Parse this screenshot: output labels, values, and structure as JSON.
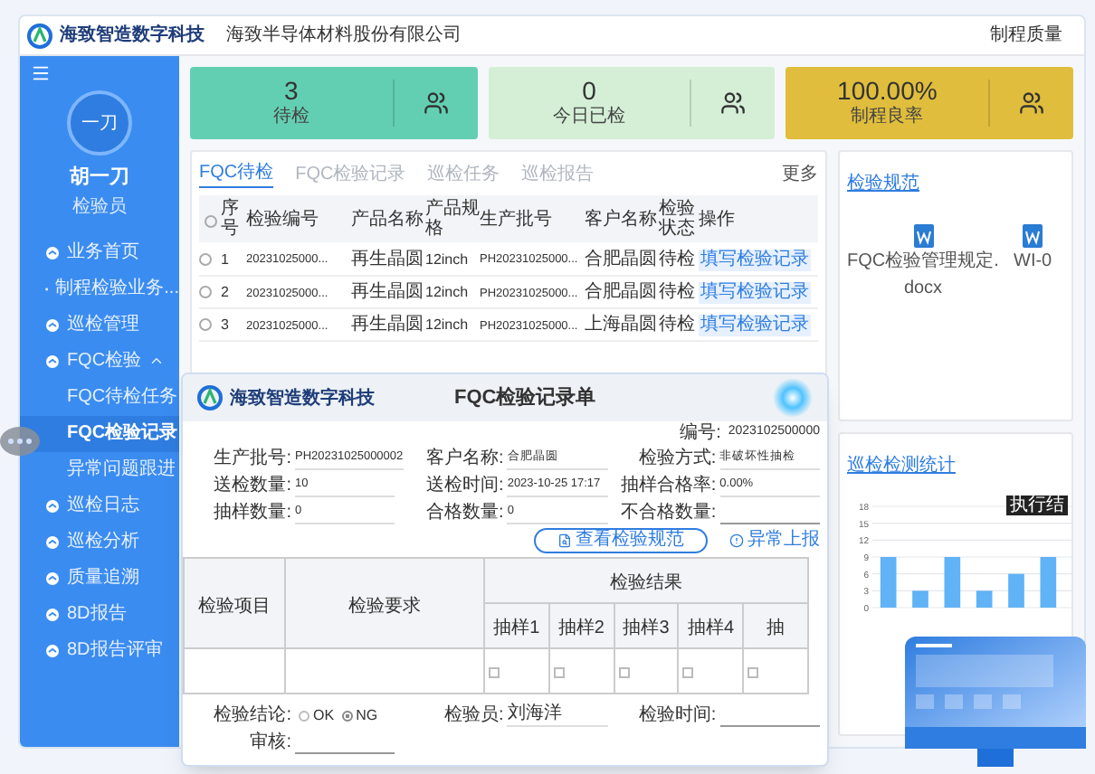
{
  "header": {
    "logo_text": "海致智造数字科技",
    "company": "海致半导体材料股份有限公司",
    "right_link": "制程质量"
  },
  "sidebar": {
    "user": {
      "avatar": "一刀",
      "name": "胡一刀",
      "role": "检验员"
    },
    "items": [
      {
        "label": "业务首页",
        "selected": false
      },
      {
        "label": "制程检验业务...",
        "selected": false
      },
      {
        "label": "巡检管理",
        "selected": false
      },
      {
        "label": "FQC检验",
        "selected": false,
        "expanded": true,
        "children": [
          {
            "label": "FQC待检任务",
            "selected": false
          },
          {
            "label": "FQC检验记录",
            "selected": true
          },
          {
            "label": "异常问题跟进",
            "selected": false
          }
        ]
      },
      {
        "label": "巡检日志",
        "selected": false
      },
      {
        "label": "巡检分析",
        "selected": false
      },
      {
        "label": "质量追溯",
        "selected": false
      },
      {
        "label": "8D报告",
        "selected": false
      },
      {
        "label": "8D报告评审",
        "selected": false
      }
    ]
  },
  "stats": [
    {
      "value": "3",
      "label": "待检",
      "color": "#63cfb2"
    },
    {
      "value": "0",
      "label": "今日已检",
      "color": "#d4efd6"
    },
    {
      "value": "100.00%",
      "label": "制程良率",
      "color": "#e0bd3c"
    }
  ],
  "tasks": {
    "tabs": [
      {
        "label": "FQC待检",
        "selected": true
      },
      {
        "label": "FQC检验记录",
        "selected": false
      },
      {
        "label": "巡检任务",
        "selected": false
      },
      {
        "label": "巡检报告",
        "selected": false
      }
    ],
    "more": "更多",
    "all_checked": false,
    "columns": [
      "序号",
      "检验编号",
      "产品名称",
      "产品规格",
      "生产批号",
      "客户名称",
      "检验状态",
      "操作"
    ],
    "rows": [
      {
        "checked": false,
        "cells": [
          "1",
          "20231025000...",
          "再生晶圆",
          "12inch",
          "PH20231025000...",
          "合肥晶圆",
          "待检"
        ],
        "action": "填写检验记录"
      },
      {
        "checked": false,
        "cells": [
          "2",
          "20231025000...",
          "再生晶圆",
          "12inch",
          "PH20231025000...",
          "合肥晶圆",
          "待检"
        ],
        "action": "填写检验记录"
      },
      {
        "checked": false,
        "cells": [
          "3",
          "20231025000...",
          "再生晶圆",
          "12inch",
          "PH20231025000...",
          "上海晶圆",
          "待检"
        ],
        "action": "填写检验记录"
      }
    ]
  },
  "spec": {
    "title": "检验规范",
    "files": [
      "FQC检验管理规定.docx",
      "WI-0"
    ]
  },
  "inspection_chart": {
    "title": "巡检检测统计",
    "tooltip": "执行结",
    "chart_data": {
      "type": "bar",
      "values": [
        9,
        3,
        9,
        3,
        6,
        9
      ],
      "ylim": [
        0,
        18
      ],
      "grid": true,
      "yticks": [
        0,
        3,
        6,
        9,
        12,
        15,
        18
      ]
    }
  },
  "record": {
    "logo_text": "海致智造数字科技",
    "title": "FQC检验记录单",
    "number_label": "编号:",
    "number": "2023102500000",
    "fields": [
      {
        "label": "生产批号:",
        "value": "PH20231025000002"
      },
      {
        "label": "客户名称:",
        "value": "合肥晶圆"
      },
      {
        "label": "检验方式:",
        "value": "非破坏性抽检"
      },
      {
        "label": "送检数量:",
        "value": "10"
      },
      {
        "label": "送检时间:",
        "value": "2023-10-25 17:17"
      },
      {
        "label": "抽样合格率:",
        "value": "0.00%"
      },
      {
        "label": "抽样数量:",
        "value": "0"
      },
      {
        "label": "合格数量:",
        "value": "0"
      },
      {
        "label": "不合格数量:"
      }
    ],
    "buttons": [
      {
        "label": "查看检验规范",
        "kind": "outline"
      },
      {
        "label": "异常上报",
        "kind": "link"
      }
    ],
    "table": {
      "columns": [
        "检验项目",
        "检验要求"
      ],
      "result_header": "检验结果",
      "samples": [
        "抽样1",
        "抽样2",
        "抽样3",
        "抽样4",
        "抽"
      ],
      "rows": [
        {
          "samples": [
            false,
            false,
            false,
            false,
            false
          ]
        }
      ]
    },
    "conclusion": {
      "label": "检验结论:",
      "options": [
        {
          "label": "OK",
          "selected": false
        },
        {
          "label": "NG",
          "selected": true
        }
      ]
    },
    "inspector": {
      "label": "检验员:",
      "value": "刘海洋"
    },
    "time": {
      "label": "检验时间:"
    },
    "review": {
      "label": "审核:"
    }
  }
}
